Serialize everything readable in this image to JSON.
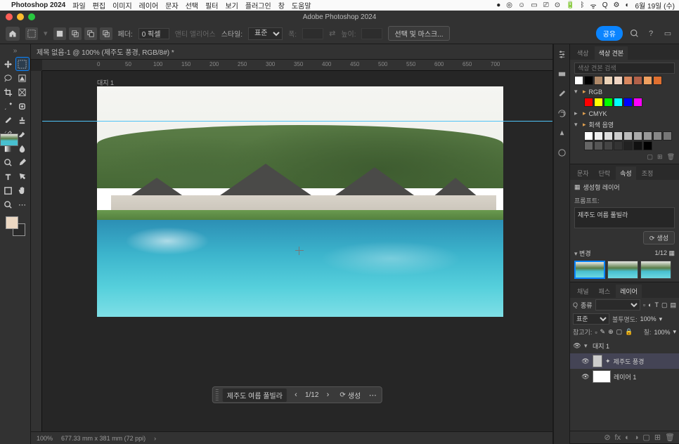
{
  "mac": {
    "app_name": "Photoshop 2024",
    "menus": [
      "파일",
      "편집",
      "이미지",
      "레이어",
      "문자",
      "선택",
      "필터",
      "보기",
      "플러그인",
      "창",
      "도움말"
    ],
    "date": "6월 19일 (수)"
  },
  "window_title": "Adobe Photoshop 2024",
  "options": {
    "feather_label": "페더:",
    "feather_value": "0 픽셀",
    "antialias_label": "앤티 앨리어스",
    "style_label": "스타일:",
    "style_value": "표준",
    "width_label": "폭:",
    "height_label": "높이:",
    "select_mask": "선택 및 마스크...",
    "share": "공유"
  },
  "doc_tab": "제목 없음-1 @ 100% (제주도 풍경, RGB/8#) *",
  "ruler_marks": [
    "0",
    "50",
    "100",
    "150",
    "200",
    "250",
    "300",
    "350",
    "400",
    "450",
    "500",
    "550",
    "600",
    "650",
    "700"
  ],
  "artboard_label": "대지 1",
  "gen_bar": {
    "prompt": "제주도 여름 풀빌라",
    "count": "1/12",
    "generate": "생성"
  },
  "status": {
    "zoom": "100%",
    "dims": "677.33 mm x 381 mm (72 ppi)"
  },
  "swatches": {
    "tab1": "색상",
    "tab2": "색상 견본",
    "search_placeholder": "색상 견본 검색",
    "folder_rgb": "RGB",
    "folder_cmyk": "CMYK",
    "folder_gray": "회색 음영"
  },
  "props": {
    "tab1": "문자",
    "tab2": "단락",
    "tab3": "속성",
    "tab4": "조정",
    "gen_layer": "생성형 레이어",
    "prompt_label": "프롬프트:",
    "prompt_value": "제주도 여름 풀빌라",
    "gen_btn": "생성",
    "variations_label": "변경",
    "variations_count": "1/12"
  },
  "layers": {
    "tab1": "채널",
    "tab2": "패스",
    "tab3": "레이어",
    "kind_label": "종류",
    "blend": "표준",
    "opacity_label": "불투명도:",
    "opacity": "100%",
    "lock_label": "참고기:",
    "fill_label": "칠:",
    "fill": "100%",
    "artboard": "대지 1",
    "layer1": "제주도 풍경",
    "layer2": "레이어 1"
  }
}
